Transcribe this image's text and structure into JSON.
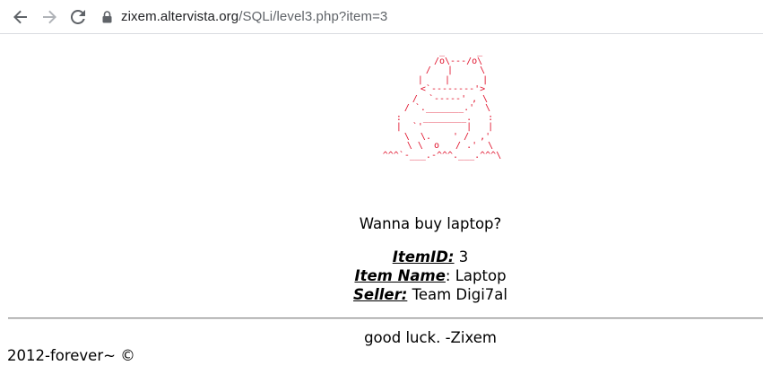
{
  "browser": {
    "url_host": "zixem.altervista.org",
    "url_path": "/SQLi/level3.php?item=3"
  },
  "page": {
    "ascii_art": "        _      _\n       /o\\---/o\\\n      /   |     \\\n     |    |      |\n     <`--------'>\n    /  `-----' , \\\n   / `._______.'  \\\n  :    ________.   :\n  |  `'        |   |\n   \\  \\.    ' /  ,'\n    \\ \\  o   / .'  \\\n ^^^`-___.-^^^.___.^^^\\\n",
    "ascii_color": "#e0102a",
    "question": "Wanna buy laptop?",
    "item_id_label": "ItemID:",
    "item_id_value": " 3",
    "item_name_label": "Item Name",
    "item_name_value": ": Laptop",
    "seller_label": "Seller:",
    "seller_value": " Team Digi7al",
    "luck_text": "good luck. -Zixem",
    "footer_text": "2012-forever~ ©"
  }
}
